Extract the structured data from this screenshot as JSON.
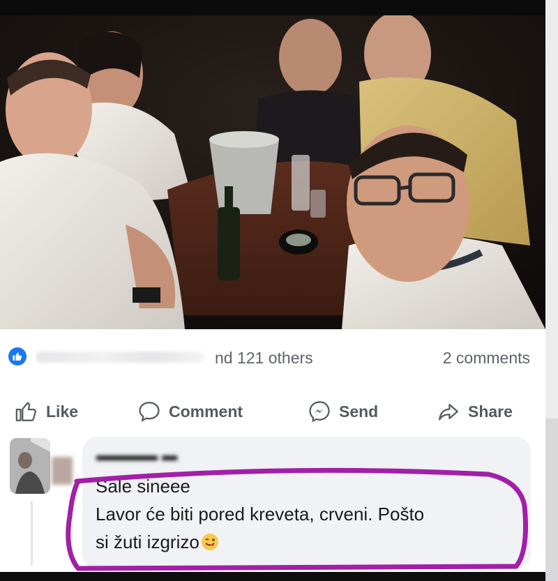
{
  "post": {
    "reactions": {
      "icon": "like-reaction-icon",
      "summary_text": "nd 121 others",
      "comments_count": "2 comments"
    },
    "actions": {
      "like": {
        "label": "Like",
        "icon": "thumbs-up-icon"
      },
      "comment": {
        "label": "Comment",
        "icon": "comment-bubble-icon"
      },
      "send": {
        "label": "Send",
        "icon": "messenger-icon"
      },
      "share": {
        "label": "Share",
        "icon": "share-arrow-icon"
      }
    }
  },
  "comment": {
    "lines": [
      "Sale sineee",
      "Lavor će biti pored kreveta, crveni. Pošto",
      "si žuti izgrizo"
    ],
    "emoji": "tongue-wink-emoji-icon"
  },
  "colors": {
    "accent": "#1877f2",
    "highlight_stroke": "#a21fa8",
    "muted_text": "#5f6368"
  }
}
